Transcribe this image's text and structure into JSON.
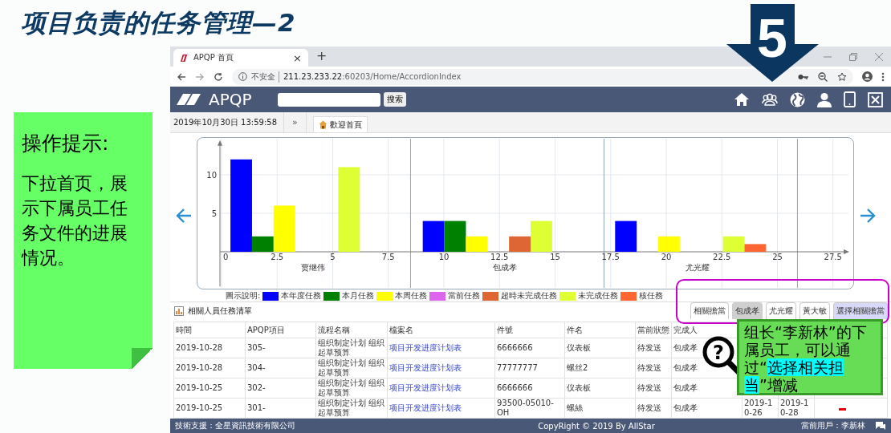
{
  "slide": {
    "title": "项目负责的任务管理—2",
    "step": "5"
  },
  "tip": {
    "heading": "操作提示:",
    "body": "下拉首页，展示下属员工任务文件的进展情况。"
  },
  "browser": {
    "tab_title": "APQP 首頁",
    "close": "×",
    "new_tab": "+",
    "security": "不安全",
    "url_host": "211.23.233.22",
    "url_path": ":60203/Home/AccordionIndex"
  },
  "app": {
    "logo": "APQP",
    "search_button": "搜索",
    "datetime": "2019年10月30日 13:59:58",
    "collapse": "»",
    "home_tab": "歡迎首頁"
  },
  "chart": {
    "legend_title": "圖示說明:",
    "scale_labels": [
      "0",
      "2.5",
      "5",
      "7.5",
      "10",
      "12.5",
      "15",
      "17.5",
      "20",
      "22.5",
      "25",
      "27.5"
    ],
    "chart_data": {
      "type": "bar",
      "categories": [
        "贾继伟",
        "包成孝",
        "尤光耀"
      ],
      "series": [
        {
          "name": "本年度任務",
          "color": "#0000ff",
          "values": [
            12,
            4,
            4
          ]
        },
        {
          "name": "本月任務",
          "color": "#008000",
          "values": [
            2,
            4,
            0
          ]
        },
        {
          "name": "本周任務",
          "color": "#ffff00",
          "values": [
            6,
            2,
            2
          ]
        },
        {
          "name": "當前任務",
          "color": "#dd66ee",
          "values": [
            0,
            0,
            0
          ]
        },
        {
          "name": "超時未完成任務",
          "color": "#dd6633",
          "values": [
            0,
            2,
            0
          ]
        },
        {
          "name": "未完成任務",
          "color": "#ddff33",
          "values": [
            11,
            4,
            2
          ]
        },
        {
          "name": "核任務",
          "color": "#ff6633",
          "values": [
            0,
            0,
            1
          ]
        }
      ],
      "ylim": [
        -4.5,
        14.5
      ],
      "yticks": [
        5,
        10
      ]
    }
  },
  "list": {
    "title": "相關人員任務清單",
    "tabs": [
      {
        "label": "相關擔當",
        "selected": false,
        "kind": "person"
      },
      {
        "label": "包成孝",
        "selected": true,
        "kind": "person"
      },
      {
        "label": "尤光耀",
        "selected": false,
        "kind": "person"
      },
      {
        "label": "黃大敏",
        "selected": false,
        "kind": "person"
      },
      {
        "label": "選擇相關擔當",
        "selected": false,
        "kind": "action"
      }
    ]
  },
  "table": {
    "columns": [
      {
        "label": "時間",
        "kind": "text"
      },
      {
        "label": "APQP項目",
        "kind": "text"
      },
      {
        "label": "流程名稱",
        "kind": "text"
      },
      {
        "label": "檔案名",
        "kind": "link"
      },
      {
        "label": "件號",
        "kind": "text"
      },
      {
        "label": "件名",
        "kind": "text"
      },
      {
        "label": "當前狀態",
        "kind": "text"
      },
      {
        "label": "完成人",
        "kind": "text"
      }
    ],
    "rows": [
      {
        "cells": [
          "2019-10-28",
          "305-",
          "组织制定计划 组织起草预算",
          "项目开发进度计划表",
          "6666666",
          "仪表板",
          "待发送",
          "包成孝"
        ]
      },
      {
        "cells": [
          "2019-10-28",
          "304-",
          "组织制定计划 组织起草预算",
          "项目开发进度计划表",
          "77777777",
          "螺丝2",
          "待发送",
          "包成孝"
        ]
      },
      {
        "cells": [
          "2019-10-25",
          "302-",
          "组织制定计划 组织起草预算",
          "项目开发进度计划表",
          "6666666",
          "仪表板",
          "待发送",
          "包成孝"
        ]
      },
      {
        "cells": [
          "2019-10-25",
          "301-",
          "组织制定计划 组织起草预算",
          "项目开发进度计划表",
          "93500-05010-OH",
          "螺絲",
          "待发送",
          "包成孝",
          "2019-10-26",
          "2019-10-28"
        ],
        "overdue": true
      }
    ]
  },
  "footer": {
    "support": "技術支援：全星資訊技術有限公司",
    "copyright": "CopyRight © 2019 By AllStar",
    "user": "當前用戶：李新林"
  },
  "magnifier": {
    "symbol": "?"
  },
  "callout": {
    "before": "组长“李新林”的下属员工，可以通过“",
    "highlight": "选择相关担当",
    "after": "”增减"
  }
}
